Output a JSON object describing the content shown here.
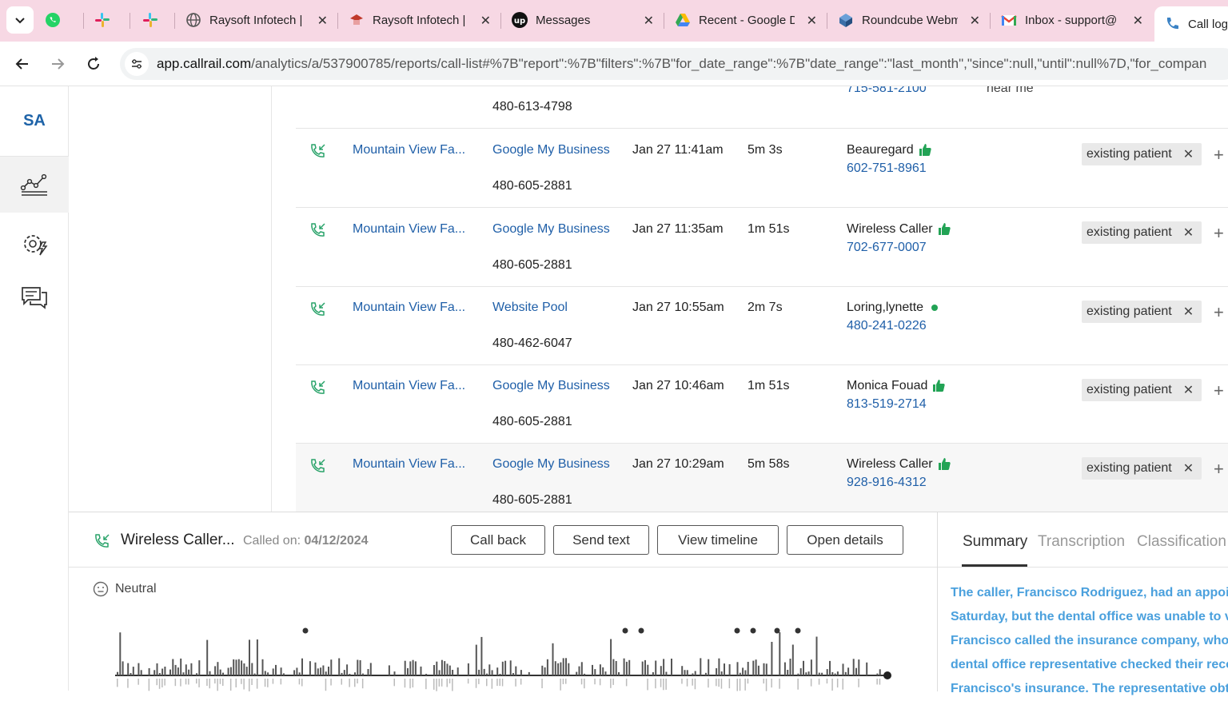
{
  "browser": {
    "tabs": [
      {
        "label": "",
        "icon": "whatsapp-icon"
      },
      {
        "label": "",
        "icon": "slack-icon"
      },
      {
        "label": "",
        "icon": "slack-icon"
      },
      {
        "label": "Raysoft Infotech |",
        "icon": "globe-icon"
      },
      {
        "label": "Raysoft Infotech |",
        "icon": "raysoft-icon"
      },
      {
        "label": "Messages",
        "icon": "upwork-icon"
      },
      {
        "label": "Recent - Google D",
        "icon": "google-drive-icon"
      },
      {
        "label": "Roundcube Webm",
        "icon": "roundcube-icon"
      },
      {
        "label": "Inbox - support@",
        "icon": "gmail-icon"
      }
    ],
    "active_tab": {
      "label": "Call log",
      "icon": "phone-icon"
    },
    "url_host": "app.callrail.com",
    "url_path": "/analytics/a/537900785/reports/call-list#%7B\"report\":%7B\"filters\":%7B\"for_date_range\":%7B\"date_range\":\"last_month\",\"since\":null,\"until\":null%7D,\"for_compan"
  },
  "sidebar": {
    "logo": "SA",
    "items": [
      {
        "name": "analytics",
        "icon": "analytics-chart-icon",
        "active": true
      },
      {
        "name": "settings",
        "icon": "gear-lightning-icon",
        "active": false
      },
      {
        "name": "conversations",
        "icon": "chat-bubbles-icon",
        "active": false
      }
    ]
  },
  "top_partial_row": {
    "tracking_number": "480-613-4798",
    "caller_number": "715-581-2100",
    "keyword": "near me\""
  },
  "calls": [
    {
      "company": "Mountain View Fa...",
      "source": "Google My Business",
      "tracking": "480-605-2881",
      "time": "Jan 27 11:41am",
      "duration": "5m 3s",
      "caller": "Beauregard",
      "phone": "602-751-8961",
      "indicator": "thumbs-up",
      "tag": "existing patient"
    },
    {
      "company": "Mountain View Fa...",
      "source": "Google My Business",
      "tracking": "480-605-2881",
      "time": "Jan 27 11:35am",
      "duration": "1m 51s",
      "caller": "Wireless Caller",
      "phone": "702-677-0007",
      "indicator": "thumbs-up",
      "tag": "existing patient"
    },
    {
      "company": "Mountain View Fa...",
      "source": "Website Pool",
      "tracking": "480-462-6047",
      "time": "Jan 27 10:55am",
      "duration": "2m 7s",
      "caller": "Loring,lynette",
      "phone": "480-241-0226",
      "indicator": "dot",
      "tag": "existing patient"
    },
    {
      "company": "Mountain View Fa...",
      "source": "Google My Business",
      "tracking": "480-605-2881",
      "time": "Jan 27 10:46am",
      "duration": "1m 51s",
      "caller": "Monica Fouad",
      "phone": "813-519-2714",
      "indicator": "thumbs-up",
      "tag": "existing patient"
    },
    {
      "company": "Mountain View Fa...",
      "source": "Google My Business",
      "tracking": "480-605-2881",
      "time": "Jan 27 10:29am",
      "duration": "5m 58s",
      "caller": "Wireless Caller",
      "phone": "928-916-4312",
      "indicator": "thumbs-up",
      "tag": "existing patient"
    }
  ],
  "detail": {
    "caller": "Wireless Caller...",
    "called_on_label": "Called on:",
    "called_on_date": "04/12/2024",
    "buttons": {
      "call_back": "Call back",
      "send_text": "Send text",
      "view_timeline": "View timeline",
      "open_details": "Open details"
    },
    "sentiment": "Neutral",
    "tabs": {
      "summary": "Summary",
      "transcription": "Transcription",
      "classification": "Classification"
    },
    "summary_lines": [
      "The caller, Francisco Rodriguez, had an appoint",
      "Saturday, but the dental office was unable to ve",
      "Francisco called the insurance company, who c",
      "dental office representative checked their reco",
      "Francisco's insurance. The representative obtai"
    ]
  },
  "colors": {
    "link": "#1f5fa8",
    "accent_green": "#22a355",
    "summary_text": "#4aa0dd",
    "tab_strip": "#f7d8e4"
  }
}
